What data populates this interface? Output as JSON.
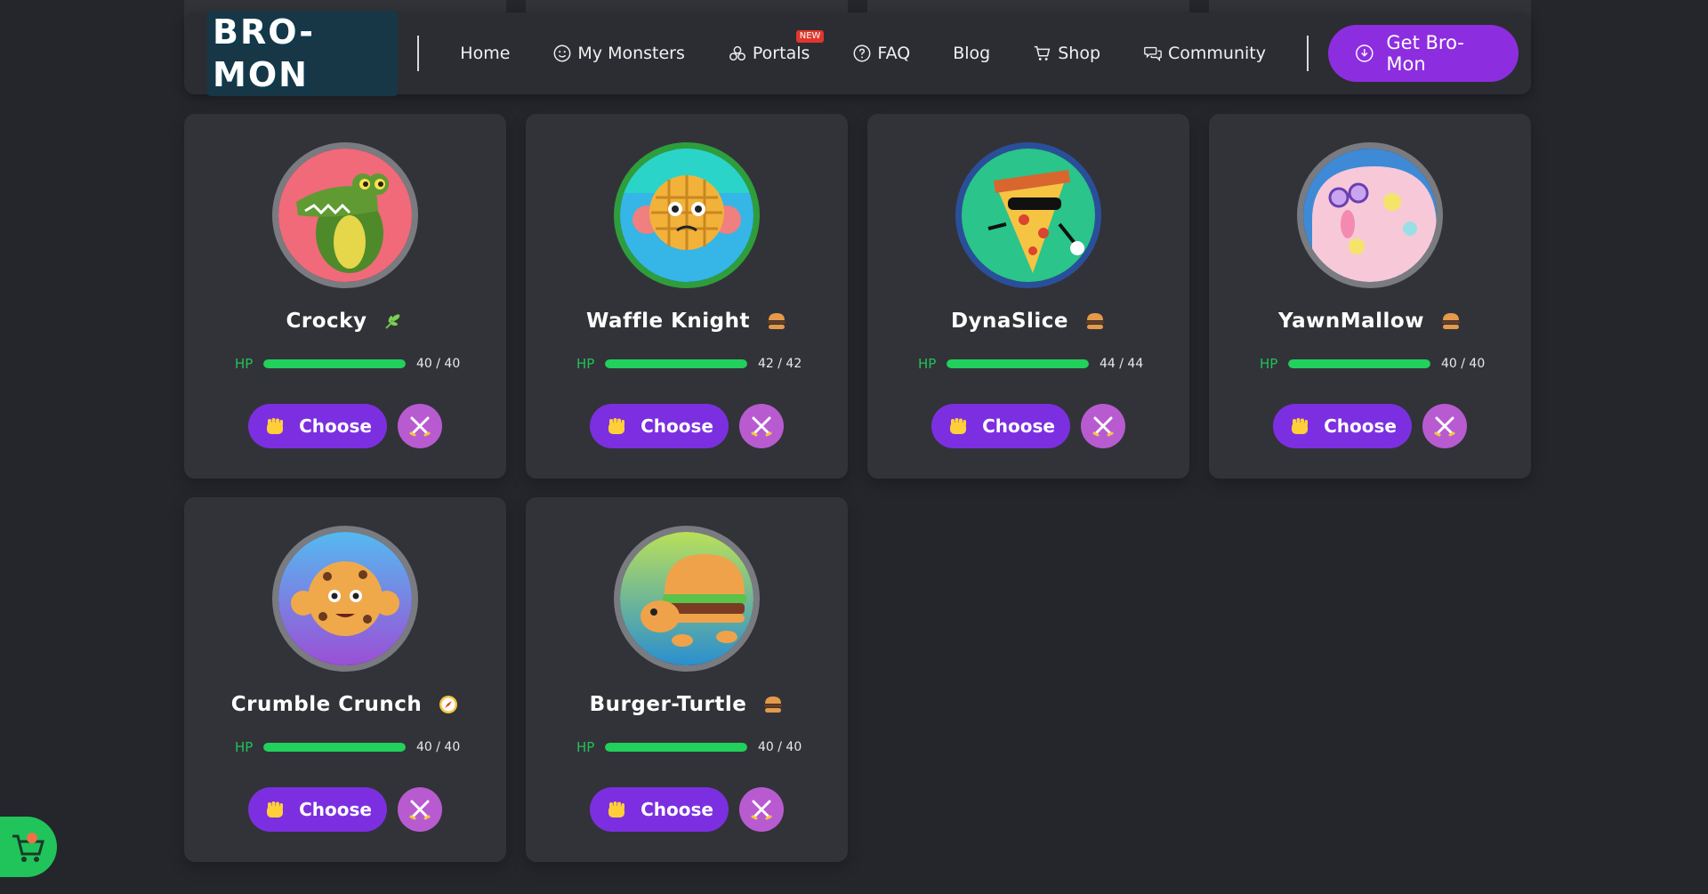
{
  "nav": {
    "logo": "BRO-MON",
    "items": [
      {
        "label": "Home",
        "icon": "none"
      },
      {
        "label": "My Monsters",
        "icon": "smiley-icon"
      },
      {
        "label": "Portals",
        "icon": "portal-icon",
        "badge": "NEW"
      },
      {
        "label": "FAQ",
        "icon": "question-icon"
      },
      {
        "label": "Blog",
        "icon": "none"
      },
      {
        "label": "Shop",
        "icon": "cart-icon"
      },
      {
        "label": "Community",
        "icon": "chat-icon"
      }
    ],
    "cta": "Get Bro-Mon"
  },
  "monsters": [
    {
      "name": "Crocky",
      "type_icon": "leaf-icon",
      "hp_label": "HP",
      "hp": "40 / 40",
      "hp_fraction": 1.0,
      "bg": "#f06a7a"
    },
    {
      "name": "Waffle Knight",
      "type_icon": "burger-icon",
      "hp_label": "HP",
      "hp": "42 / 42",
      "hp_fraction": 1.0,
      "bg": "#35b6e6"
    },
    {
      "name": "DynaSlice",
      "type_icon": "burger-icon",
      "hp_label": "HP",
      "hp": "44 / 44",
      "hp_fraction": 1.0,
      "bg": "#2bc48a"
    },
    {
      "name": "YawnMallow",
      "type_icon": "burger-icon",
      "hp_label": "HP",
      "hp": "40 / 40",
      "hp_fraction": 1.0,
      "bg": "#3e8ad6"
    },
    {
      "name": "Crumble Crunch",
      "type_icon": "compass-icon",
      "hp_label": "HP",
      "hp": "40 / 40",
      "hp_fraction": 1.0,
      "bg": "#8b5ed8"
    },
    {
      "name": "Burger-Turtle",
      "type_icon": "burger-icon",
      "hp_label": "HP",
      "hp": "40 / 40",
      "hp_fraction": 1.0,
      "bg": "#39a8d4"
    }
  ],
  "buttons": {
    "choose": "Choose"
  },
  "colors": {
    "accent": "#8d2de0",
    "hp": "#22d05c",
    "battle": "#b85bd1",
    "background": "#25262c",
    "card": "#323338"
  }
}
